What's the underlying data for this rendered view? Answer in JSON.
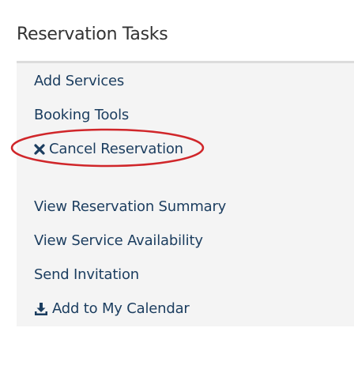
{
  "panel": {
    "title": "Reservation Tasks"
  },
  "tasks": [
    {
      "label": "Add Services",
      "icon": null
    },
    {
      "label": "Booking Tools",
      "icon": null
    },
    {
      "label": "Cancel Reservation",
      "icon": "close-icon"
    },
    {
      "label": "View Reservation Summary",
      "icon": null
    },
    {
      "label": "View Service Availability",
      "icon": null
    },
    {
      "label": "Send Invitation",
      "icon": null
    },
    {
      "label": "Add to My Calendar",
      "icon": "download-icon"
    }
  ],
  "colors": {
    "link": "#1b3d5f",
    "panel_background": "#f4f4f4",
    "panel_border": "#dcdcdc",
    "annotation": "#d0262a"
  }
}
